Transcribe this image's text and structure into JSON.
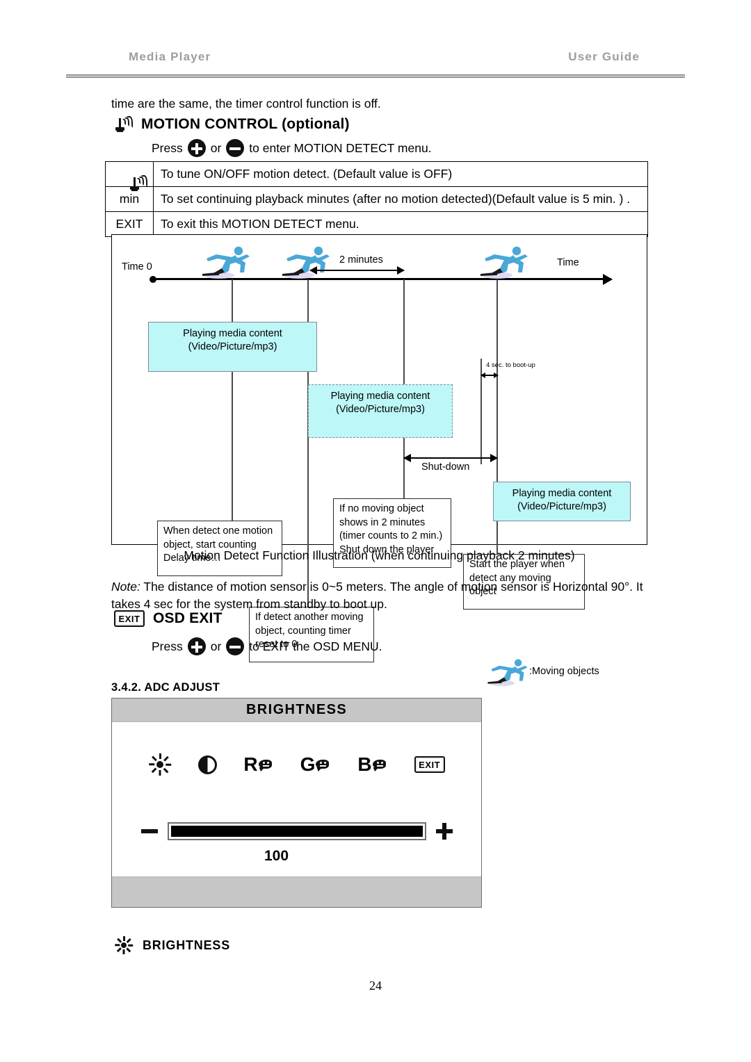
{
  "header": {
    "left": "Media  Player",
    "right": "User  Guide"
  },
  "lead_line": "time are the same, the timer control function is off.",
  "motion_control": {
    "icon": "motion-sensor-icon",
    "title": "MOTION CONTROL (optional)",
    "press_prefix": "Press",
    "press_or": "or",
    "press_suffix": "to enter MOTION DETECT menu.",
    "plus_icon": "plus-button-icon",
    "minus_icon": "minus-button-icon"
  },
  "menu_table": {
    "rows": [
      {
        "key": "",
        "key_icon": "motion-sensor-icon",
        "desc": "To tune ON/OFF motion detect. (Default value is OFF)"
      },
      {
        "key": "min",
        "key_icon": "",
        "desc": "To set continuing playback minutes (after no motion detected)(Default value is 5 min. ) ."
      },
      {
        "key": "EXIT",
        "key_icon": "",
        "desc": "To exit this MOTION DETECT menu."
      }
    ]
  },
  "diagram": {
    "axis_start_label": "Time 0",
    "axis_end_label": "Time",
    "measure_two_minutes": "2 minutes",
    "measure_bootup": "4 sec. to boot-up",
    "measure_shutdown": "Shut-down",
    "play_box_1": {
      "line1": "Playing  media content",
      "line2": "(Video/Picture/mp3)"
    },
    "play_box_2": {
      "line1": "Playing  media content",
      "line2": "(Video/Picture/mp3)"
    },
    "play_box_3": {
      "line1": "Playing  media content",
      "line2": "(Video/Picture/mp3)"
    },
    "note_1": "When detect one motion object, start counting Delay time…",
    "note_2": "If detect another moving object, counting timer reset to 0",
    "note_3": "If no moving object shows in 2 minutes (timer counts to 2 min.) Shut down the player",
    "note_4": "Start the player when detect any moving object",
    "legend_label": ":Moving objects",
    "legend_icon": "running-person-icon",
    "runner_icon": "running-person-icon"
  },
  "diagram_caption": "Motion Detect Function Illustration (when continuing playback 2 minutes)",
  "note_paragraph": {
    "label": "Note:",
    "text": " The distance of motion sensor is 0~5 meters. The angle of motion sensor is Horizontal 90°. It takes 4 sec for the system from standby to boot up."
  },
  "osd_exit": {
    "badge": "EXIT",
    "title": "OSD EXIT",
    "press_prefix": "Press",
    "press_or": "or",
    "press_suffix": "to EXIT the OSD MENU.",
    "plus_icon": "plus-button-icon",
    "minus_icon": "minus-button-icon"
  },
  "adc_adjust": {
    "section_number": "3.4.2. ADC ADJUST"
  },
  "osd_panel": {
    "title": "BRIGHTNESS",
    "icons": [
      {
        "name": "brightness-sun-icon",
        "label": ""
      },
      {
        "name": "contrast-icon",
        "label": ""
      },
      {
        "name": "red-gain-icon",
        "label": "R"
      },
      {
        "name": "green-gain-icon",
        "label": "G"
      },
      {
        "name": "blue-gain-icon",
        "label": "B"
      },
      {
        "name": "exit-badge-icon",
        "label": "EXIT"
      }
    ],
    "minus_icon": "minus-icon",
    "plus_icon": "plus-icon",
    "value": "100",
    "fill_percent": 100
  },
  "osd_legend": {
    "icon": "brightness-sun-icon",
    "label": "BRIGHTNESS"
  },
  "page_number": "24",
  "colors": {
    "cyan_box": "#bdf7f7",
    "panel_gray": "#c6c6c6",
    "header_gray": "#9d9d9d",
    "runner_blue": "#4aa8d8"
  }
}
